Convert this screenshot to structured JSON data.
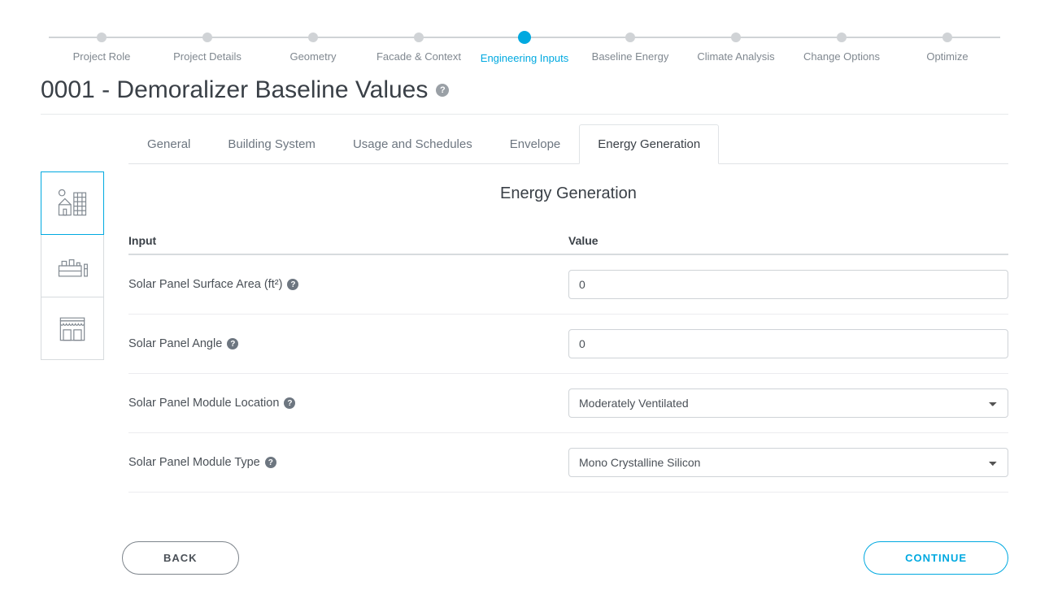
{
  "stepper": {
    "activeIndex": 4,
    "steps": [
      {
        "label": "Project Role"
      },
      {
        "label": "Project Details"
      },
      {
        "label": "Geometry"
      },
      {
        "label": "Facade & Context"
      },
      {
        "label": "Engineering Inputs"
      },
      {
        "label": "Baseline Energy"
      },
      {
        "label": "Climate Analysis"
      },
      {
        "label": "Change Options"
      },
      {
        "label": "Optimize"
      }
    ]
  },
  "titleBar": {
    "title": "0001 - Demoralizer Baseline Values"
  },
  "tabs": {
    "activeIndex": 4,
    "items": [
      {
        "label": "General"
      },
      {
        "label": "Building System"
      },
      {
        "label": "Usage and Schedules"
      },
      {
        "label": "Envelope"
      },
      {
        "label": "Energy Generation"
      }
    ]
  },
  "section": {
    "title": "Energy Generation"
  },
  "table": {
    "head": {
      "input": "Input",
      "value": "Value"
    },
    "rows": [
      {
        "label": "Solar Panel Surface Area (ft²)",
        "type": "text",
        "value": "0"
      },
      {
        "label": "Solar Panel Angle",
        "type": "text",
        "value": "0"
      },
      {
        "label": "Solar Panel Module Location",
        "type": "select",
        "value": "Moderately Ventilated"
      },
      {
        "label": "Solar Panel Module Type",
        "type": "select",
        "value": "Mono Crystalline Silicon"
      }
    ]
  },
  "buttons": {
    "back": "BACK",
    "continue": "CONTINUE"
  },
  "sideIcons": {
    "activeIndex": 0,
    "items": [
      {
        "name": "office-icon"
      },
      {
        "name": "residential-icon"
      },
      {
        "name": "retail-icon"
      }
    ]
  }
}
